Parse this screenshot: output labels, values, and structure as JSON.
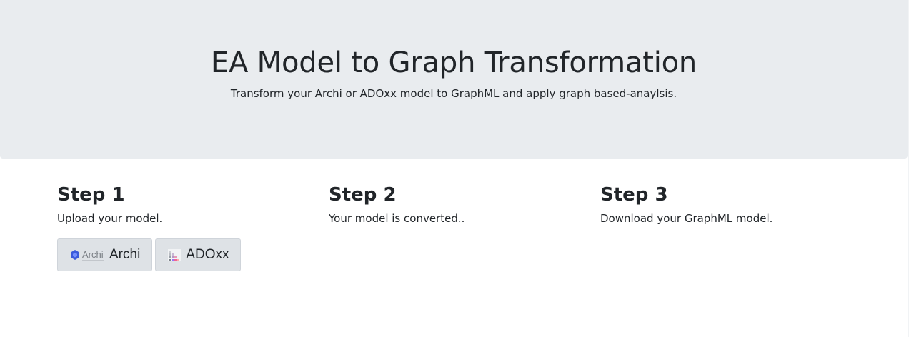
{
  "hero": {
    "title": "EA Model to Graph Transformation",
    "subtitle": "Transform your Archi or ADOxx model to GraphML and apply graph based-anaylsis."
  },
  "steps": [
    {
      "heading": "Step 1",
      "text": "Upload your model.",
      "buttons": [
        {
          "label": "Archi",
          "logo_text": "Archi",
          "icon": "archi-logo-icon",
          "accent": "#3b5bdb"
        },
        {
          "label": "ADOxx",
          "icon": "adoxx-logo-icon"
        }
      ]
    },
    {
      "heading": "Step 2",
      "text": "Your model is converted.."
    },
    {
      "heading": "Step 3",
      "text": "Download your GraphML model."
    }
  ],
  "colors": {
    "hero_background": "#e9ecef",
    "button_background": "#dee2e6",
    "text": "#212529"
  }
}
